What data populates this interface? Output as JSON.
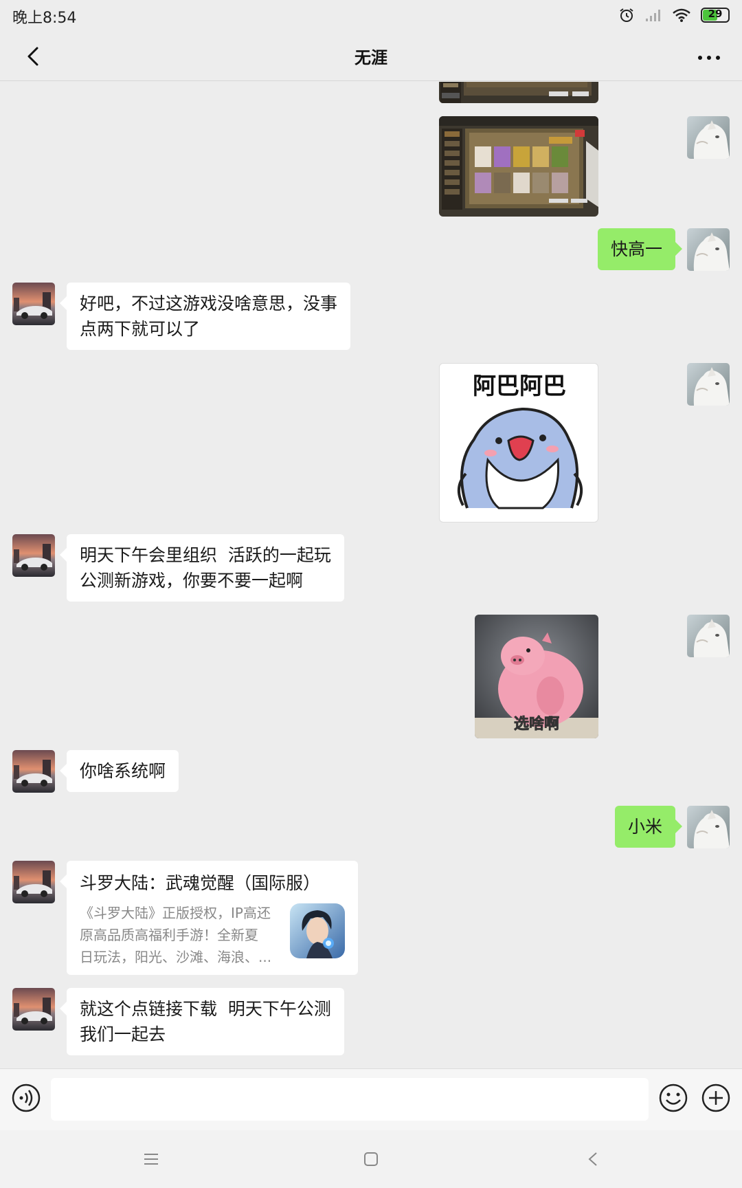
{
  "status_bar": {
    "time": "晚上8:54",
    "battery": "29",
    "icons": [
      "alarm-icon",
      "signal-icon",
      "wifi-icon",
      "battery-icon"
    ]
  },
  "header": {
    "title": "无涯",
    "back_icon": "chevron-left-icon",
    "more_icon": "more-dots-icon"
  },
  "messages": [
    {
      "side": "right",
      "type": "image",
      "content": "game screenshot"
    },
    {
      "side": "right",
      "type": "image",
      "content": "game screenshot"
    },
    {
      "side": "right",
      "type": "text",
      "text": "快高一"
    },
    {
      "side": "left",
      "type": "text",
      "lines": [
        "好吧，不过这游戏没啥意思，没事",
        "点两下就可以了"
      ]
    },
    {
      "side": "right",
      "type": "sticker",
      "sticker_text": "阿巴阿巴"
    },
    {
      "side": "left",
      "type": "text",
      "lines": [
        "明天下午会里组织  活跃的一起玩",
        "公测新游戏，你要不要一起啊"
      ]
    },
    {
      "side": "right",
      "type": "sticker",
      "sticker_text": "选啥啊"
    },
    {
      "side": "left",
      "type": "text",
      "text": "你啥系统啊"
    },
    {
      "side": "right",
      "type": "text",
      "text": "小米"
    },
    {
      "side": "left",
      "type": "link",
      "title": "斗罗大陆：武魂觉醒（国际服）",
      "desc_lines": [
        "《斗罗大陆》正版授权，IP高还",
        "原高品质高福利手游！全新夏",
        "日玩法，阳光、沙滩、海浪、..."
      ]
    },
    {
      "side": "left",
      "type": "text",
      "lines": [
        "就这个点链接下载  明天下午公测",
        "我们一起去"
      ]
    }
  ],
  "input_bar": {
    "value": "",
    "voice_icon": "voice-icon",
    "emoji_icon": "emoji-icon",
    "plus_icon": "plus-icon"
  },
  "nav_bar": {
    "icons": [
      "menu-icon",
      "home-square-icon",
      "back-triangle-icon"
    ]
  },
  "colors": {
    "background": "#ededed",
    "bubble_self": "#95ec69",
    "bubble_other": "#ffffff"
  }
}
